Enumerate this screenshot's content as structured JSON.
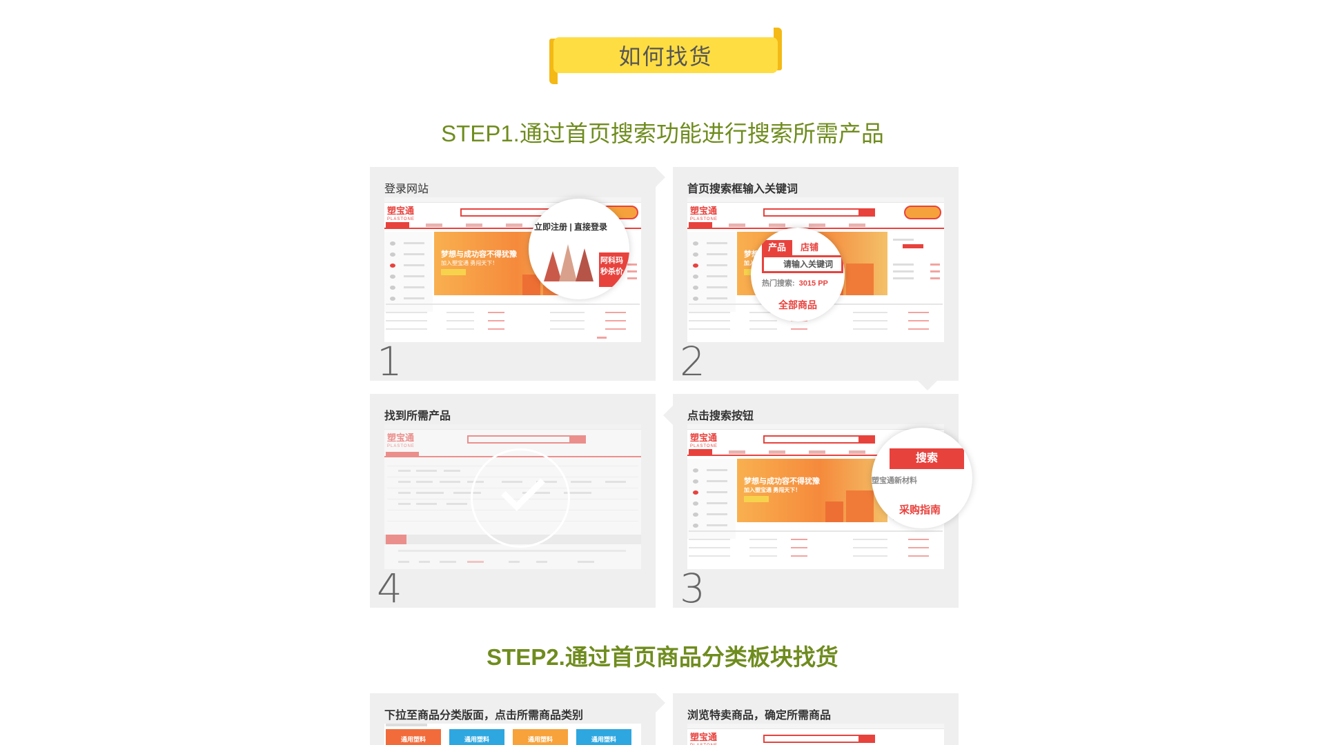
{
  "banner": {
    "title": "如何找货"
  },
  "step1": {
    "title": "STEP1.通过首页搜索功能进行搜索所需产品",
    "cards": [
      {
        "number": "1",
        "caption": "登录网站"
      },
      {
        "number": "2",
        "caption": "首页搜索框输入关键词"
      },
      {
        "number": "3",
        "caption": "点击搜索按钮"
      },
      {
        "number": "4",
        "caption": "找到所需产品"
      }
    ]
  },
  "step2": {
    "title": "STEP2.通过首页商品分类板块找货",
    "cards": [
      {
        "caption": "下拉至商品分类版面，点击所需商品类别"
      },
      {
        "caption": "浏览特卖商品，确定所需商品"
      }
    ]
  },
  "site": {
    "logo": "塑宝通",
    "logo_en": "PLASTONE",
    "hero_line1": "梦想与成功容不得犹豫",
    "hero_line2": "加入塑宝通 勇闯天下！"
  },
  "zoom1": {
    "links": "立即注册 | 直接登录",
    "side_text": "阿科玛 秒杀价"
  },
  "zoom2": {
    "tab_product": "产品",
    "tab_shop": "店铺",
    "placeholder": "请输入关键词",
    "hot_label": "热门搜索:",
    "hot_items": "3015   PP",
    "all_products": "全部商品"
  },
  "zoom3": {
    "search_button": "搜索",
    "sub_text": "塑宝通新材料",
    "guide": "采购指南"
  },
  "categories": [
    {
      "label": "通用塑料",
      "color": "#f26b3a"
    },
    {
      "label": "通用塑料",
      "color": "#2ea7e0"
    },
    {
      "label": "通用塑料",
      "color": "#f7a23a"
    },
    {
      "label": "通用塑料",
      "color": "#2ea7e0"
    }
  ],
  "colors": {
    "accent": "#e8423d",
    "step_title": "#6f8c1e",
    "banner": "#fedd43"
  }
}
